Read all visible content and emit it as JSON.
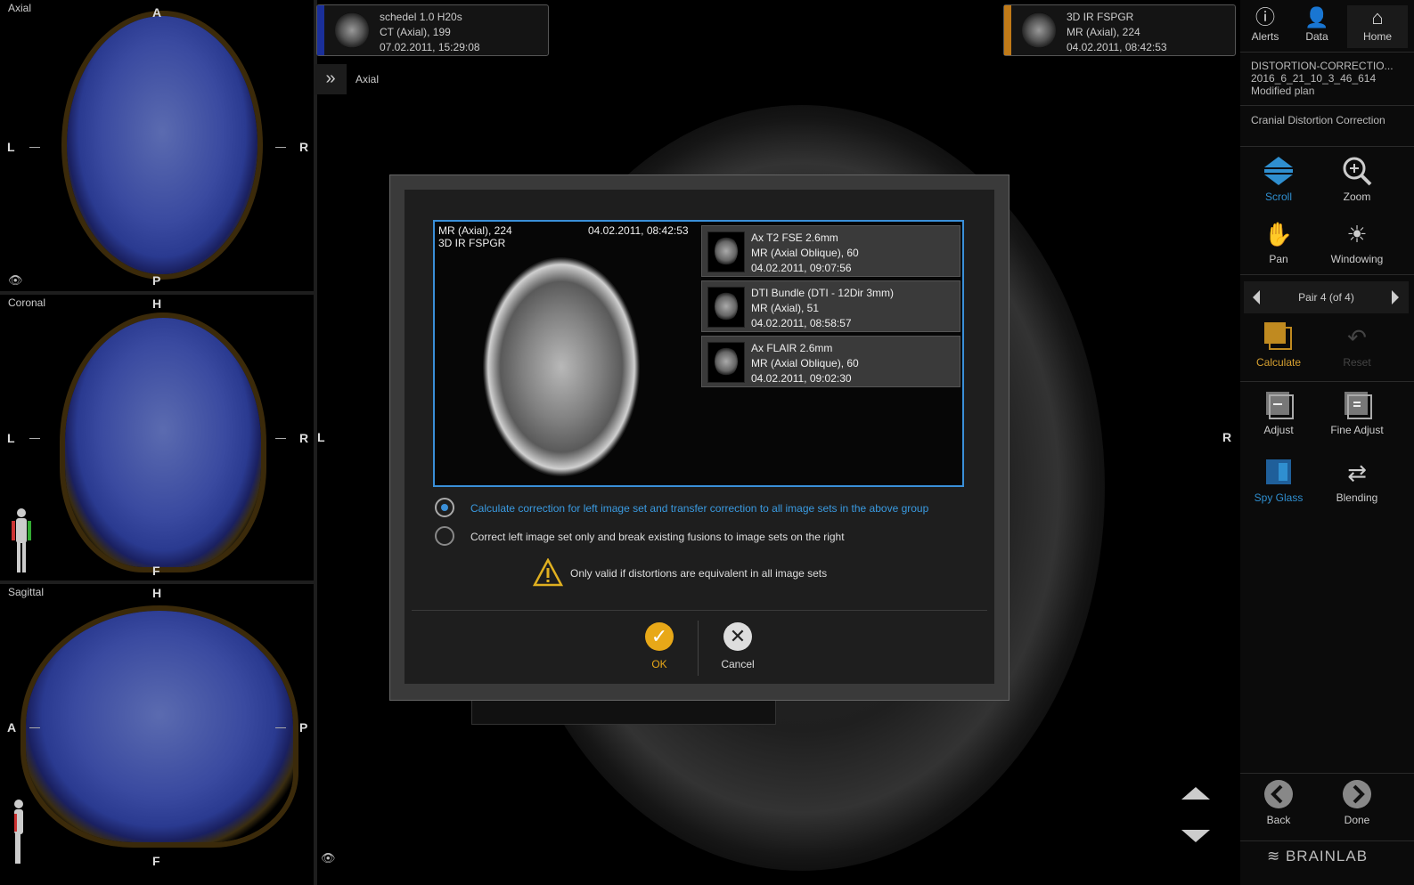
{
  "left_views": {
    "axial": {
      "title": "Axial",
      "top": "A",
      "bottom": "P",
      "left": "L",
      "right": "R"
    },
    "coronal": {
      "title": "Coronal",
      "top": "H",
      "bottom": "F",
      "left": "L",
      "right": "R"
    },
    "sagittal": {
      "title": "Sagittal",
      "top": "H",
      "bottom": "F",
      "left": "A",
      "right": "P"
    }
  },
  "series_left": {
    "line1": "schedel 1.0 H20s",
    "line2": "CT (Axial), 199",
    "line3": "07.02.2011, 15:29:08",
    "color": "#1a2f9a"
  },
  "series_right": {
    "line1": "3D IR FSPGR",
    "line2": "MR (Axial), 224",
    "line3": "04.02.2011, 08:42:53",
    "color": "#c07a18"
  },
  "main_view": {
    "label": "Axial",
    "left": "L",
    "right": "R"
  },
  "right_panel": {
    "top_buttons": [
      {
        "label": "Alerts",
        "icon": "info-icon"
      },
      {
        "label": "Data",
        "icon": "data-icon"
      },
      {
        "label": "Home",
        "icon": "home-icon"
      }
    ],
    "plan_name": "DISTORTION-CORRECTIO...",
    "plan_id": "2016_6_21_10_3_46_614",
    "plan_status": "Modified plan",
    "workflow": "Cranial Distortion Correction",
    "tools": {
      "scroll": "Scroll",
      "zoom": "Zoom",
      "pan": "Pan",
      "windowing": "Windowing",
      "pair": "Pair 4 (of 4)",
      "calculate": "Calculate",
      "reset": "Reset",
      "adjust": "Adjust",
      "fine_adjust": "Fine Adjust",
      "spy_glass": "Spy Glass",
      "blending": "Blending",
      "back": "Back",
      "done": "Done"
    },
    "brand": "BRAINLAB"
  },
  "dialog": {
    "preview": {
      "line1": "MR (Axial), 224",
      "line2": "3D IR FSPGR",
      "date": "04.02.2011, 08:42:53"
    },
    "pairs": [
      {
        "line1": "Ax T2 FSE 2.6mm",
        "line2": "MR (Axial Oblique), 60",
        "line3": "04.02.2011, 09:07:56"
      },
      {
        "line1": "DTI Bundle (DTI - 12Dir 3mm)",
        "line2": "MR (Axial), 51",
        "line3": "04.02.2011, 08:58:57"
      },
      {
        "line1": "Ax FLAIR 2.6mm",
        "line2": "MR (Axial Oblique), 60",
        "line3": "04.02.2011, 09:02:30"
      }
    ],
    "option1": "Calculate correction for left image set and transfer correction to all image sets in the above group",
    "option2": "Correct left image set only and break existing fusions to image sets on the right",
    "warning": "Only valid if distortions are equivalent in all image sets",
    "ok": "OK",
    "cancel": "Cancel"
  },
  "colors": {
    "accent_blue": "#3a8fd8",
    "accent_orange": "#e0a020"
  }
}
